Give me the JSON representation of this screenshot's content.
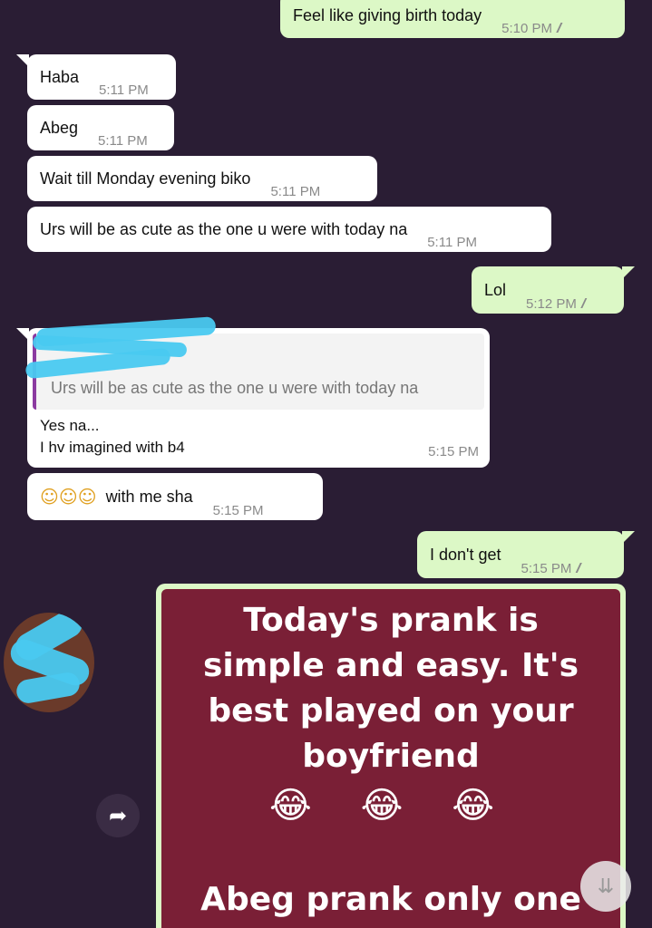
{
  "messages": [
    {
      "text": "Feel like giving birth today",
      "time": "5:10 PM",
      "ticks": "//"
    },
    {
      "text": "Haba",
      "time": "5:11 PM"
    },
    {
      "text": "Abeg",
      "time": "5:11 PM"
    },
    {
      "text": "Wait till Monday evening biko",
      "time": "5:11 PM"
    },
    {
      "text": "Urs will be as cute as the one u were with today na",
      "time": "5:11 PM"
    },
    {
      "text": "Lol",
      "time": "5:12 PM",
      "ticks": "//"
    },
    {
      "quoted": "Urs will be as cute as the one u were with today na",
      "line1": "Yes na...",
      "line2": "I hv imagined with b4",
      "time": "5:15 PM"
    },
    {
      "emojis": "☺☺☺",
      "text": "with me sha",
      "time": "5:15 PM"
    },
    {
      "text": "I don't get",
      "time": "5:15 PM",
      "ticks": "//"
    }
  ],
  "image": {
    "line1": "Today's prank is",
    "line2": "simple and easy. It's",
    "line3": "best played on your",
    "line4": "boyfriend",
    "emojis": "😂 😂 😂",
    "footer": "Abeg prank only one"
  },
  "icons": {
    "forward": "forward-arrow-icon",
    "scroll_down": "double-chevron-down-icon"
  },
  "colors": {
    "background": "#2a1d34",
    "incoming": "#ffffff",
    "outgoing": "#dcf8c6",
    "image_bg": "#7a1f36",
    "reply_bar": "#8b3aa0"
  }
}
